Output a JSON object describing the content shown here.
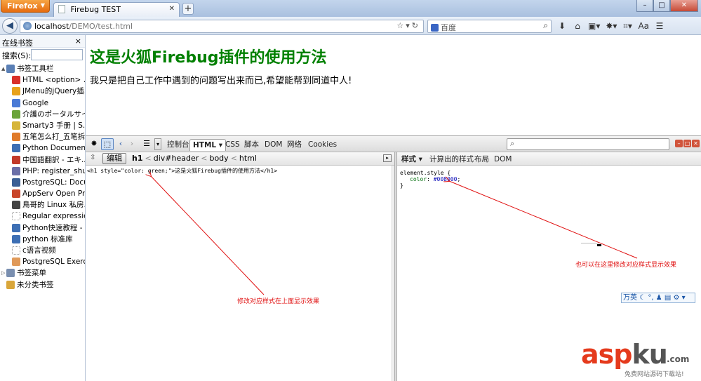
{
  "browser": {
    "menu_button": "Firefox",
    "tab_title": "Firebug TEST",
    "new_tab": "+",
    "window_controls": [
      "–",
      "□",
      "✕"
    ]
  },
  "nav": {
    "url_host": "localhost",
    "url_path": "/DEMO/test.html",
    "search_placeholder": "百度",
    "icons": [
      "download-icon",
      "home-icon",
      "screenshot-icon",
      "firebug-icon",
      "crop-icon",
      "font-icon",
      "menu-icon"
    ]
  },
  "sidebar": {
    "title": "在线书签",
    "close": "×",
    "search_label": "搜索(S):",
    "items": [
      {
        "label": "书签工具栏",
        "level": 0,
        "color": "#5a7fb5",
        "twisty": "▲"
      },
      {
        "label": "HTML <option> ...",
        "level": 1,
        "color": "#d9302a"
      },
      {
        "label": "JMenu的jQuery插...",
        "level": 1,
        "color": "#e8a21c"
      },
      {
        "label": "Google",
        "level": 1,
        "color": "#4a7ad6"
      },
      {
        "label": "介護のポータルサイ...",
        "level": 1,
        "color": "#6ba43a"
      },
      {
        "label": "Smarty3 手册 | S...",
        "level": 1,
        "color": "#d6b53a"
      },
      {
        "label": "五笔怎么打_五笔拆...",
        "level": 1,
        "color": "#e07b2a"
      },
      {
        "label": "Python Document...",
        "level": 1,
        "color": "#3d6fb4"
      },
      {
        "label": "中国語翻訳 - エキ...",
        "level": 1,
        "color": "#c23a2a"
      },
      {
        "label": "PHP: register_shu...",
        "level": 1,
        "color": "#6b6fa8"
      },
      {
        "label": "PostgreSQL: Docu...",
        "level": 1,
        "color": "#3a5f95"
      },
      {
        "label": "AppServ Open Pro...",
        "level": 1,
        "color": "#c9462a"
      },
      {
        "label": "鳥哥的 Linux 私房...",
        "level": 1,
        "color": "#444444"
      },
      {
        "label": "Regular expressio...",
        "level": 1,
        "color": "#ffffff"
      },
      {
        "label": "Python快速教程 - ...",
        "level": 1,
        "color": "#3d6fb4"
      },
      {
        "label": "python 标准库",
        "level": 1,
        "color": "#3d6fb4"
      },
      {
        "label": "c语言视频",
        "level": 1,
        "color": "#ffffff"
      },
      {
        "label": "PostgreSQL Exerci...",
        "level": 1,
        "color": "#e09a5a"
      },
      {
        "label": "书签菜单",
        "level": 0,
        "color": "#7a8fb0",
        "twisty": "▷"
      },
      {
        "label": "未分类书签",
        "level": 0,
        "color": "#d9a63a",
        "twisty": ""
      }
    ]
  },
  "page": {
    "heading": "这是火狐Firebug插件的使用方法",
    "paragraph": "我只是把自己工作中遇到的问题写出来而已,希望能帮到同道中人!"
  },
  "firebug": {
    "tabs": [
      "控制台",
      "HTML ▾",
      "CSS",
      "脚本",
      "DOM",
      "网络",
      "Cookies"
    ],
    "edit_button": "编辑",
    "breadcrumbs": [
      "h1",
      "div#header",
      "body",
      "html"
    ],
    "html_source": "<h1 style=\"color: green;\">这是火狐Firebug插件的使用方法</h1>",
    "side_tabs": [
      "样式 ▾",
      "计算出的样式",
      "布局",
      "DOM"
    ],
    "css": {
      "selector": "element.style {",
      "prop": "color",
      "value": "#008000",
      "close": "}"
    }
  },
  "annotations": {
    "left": "修改对应样式在上面显示效果",
    "right": "也可以在这里修改对应样式显示效果"
  },
  "ime": {
    "text": "万英 ☾ °, ♟ ▤ ⚙ ▾"
  },
  "watermark": {
    "logo_asp": "asp",
    "logo_ku": "ku",
    "logo_com": ".com",
    "tagline": "免费网站源码下载站!"
  },
  "colors": {
    "heading": "#008000",
    "annotation": "#e01010",
    "accent": "#e66b0e"
  }
}
